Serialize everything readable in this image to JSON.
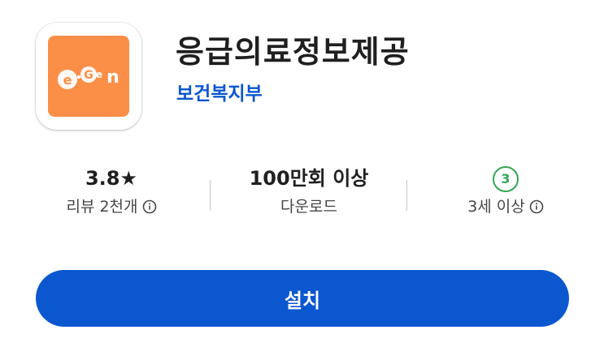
{
  "app": {
    "title": "응급의료정보제공",
    "developer": "보건복지부",
    "icon": {
      "name": "egen-logo",
      "text": "E·Gen",
      "background": "#fb8f48"
    }
  },
  "stats": {
    "rating": {
      "value": "3.8★",
      "label": "리뷰 2천개"
    },
    "downloads": {
      "value": "100만회 이상",
      "label": "다운로드"
    },
    "age": {
      "badge": "3",
      "label": "3세 이상",
      "badge_color": "#34a853"
    }
  },
  "install": {
    "label": "설치",
    "color": "#0b57d0"
  },
  "icons": {
    "info": "info-icon"
  }
}
